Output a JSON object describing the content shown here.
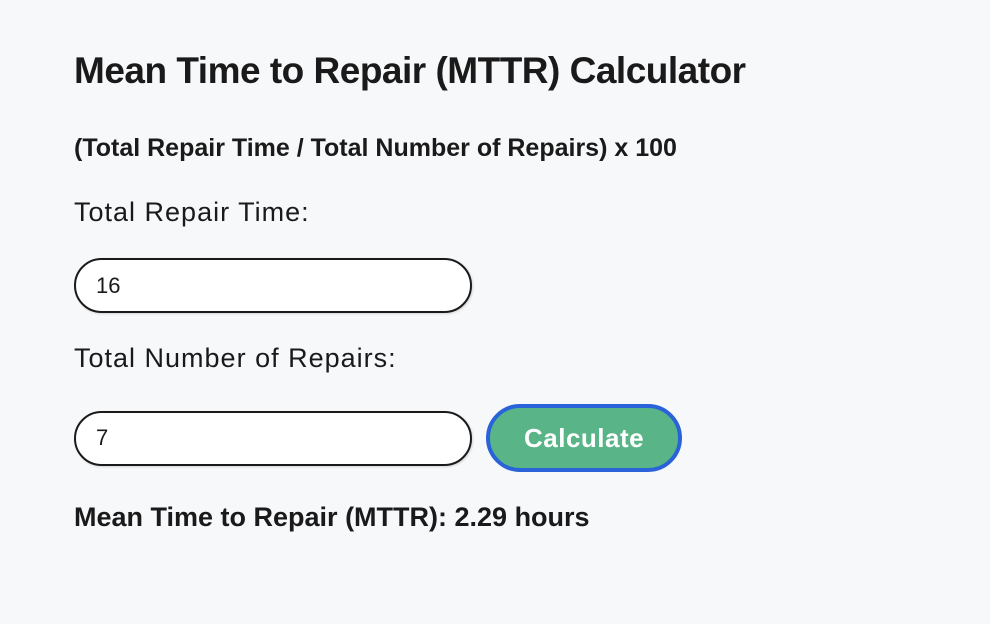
{
  "title": "Mean Time to Repair (MTTR) Calculator",
  "formula": "(Total Repair Time / Total Number of Repairs) x 100",
  "field_repair_time": {
    "label": "Total Repair Time:",
    "value": "16"
  },
  "field_num_repairs": {
    "label": "Total Number of Repairs:",
    "value": "7"
  },
  "calculate_button_label": "Calculate",
  "result_text": "Mean Time to Repair (MTTR): 2.29 hours"
}
